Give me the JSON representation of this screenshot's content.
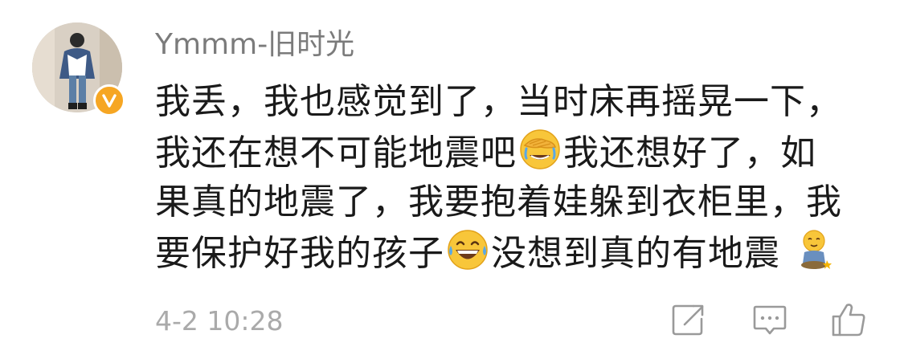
{
  "comment": {
    "author": {
      "username": "Ymmm-旧时光",
      "verified": true,
      "avatar_icon": "avatar-photo"
    },
    "body_lines": [
      {
        "text": "我丢，我也感觉到了，当时床再摇晃一下，",
        "emoji": null,
        "after": ""
      },
      {
        "text": "我还在想不可能地震吧",
        "emoji": "facepalm-crying-emoji",
        "after": "我还想好了，如"
      },
      {
        "text": "果真的地震了，我要抱着娃躲到衣柜里，我",
        "emoji": null,
        "after": ""
      },
      {
        "text": "要保护好我的孩子",
        "emoji": "laughing-tears-emoji",
        "after": "没想到真的有地震"
      }
    ],
    "trailing_emoji": "sitting-doll-emoji",
    "timestamp": "4-2 10:28",
    "actions": [
      {
        "name": "repost",
        "icon": "repost-icon"
      },
      {
        "name": "comment",
        "icon": "comment-icon"
      },
      {
        "name": "like",
        "icon": "thumbs-up-icon"
      }
    ]
  },
  "colors": {
    "username": "#7b7b7b",
    "body_text": "#1a1a1a",
    "meta": "#aaaaaa",
    "badge": "#f6a623",
    "icon": "#9a9a9a"
  }
}
